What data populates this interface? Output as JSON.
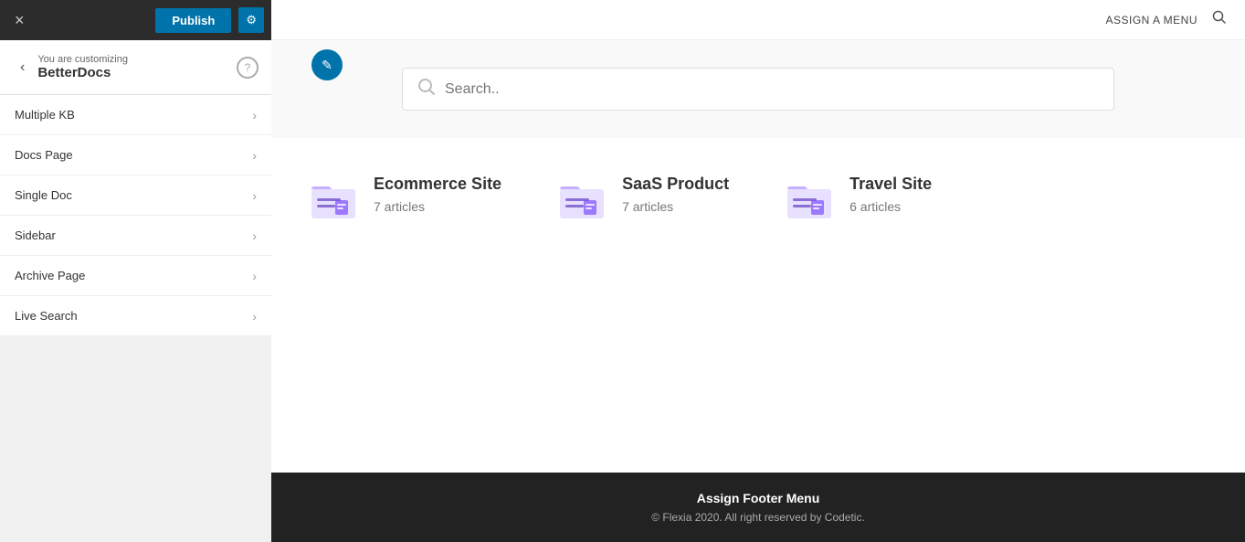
{
  "toolbar": {
    "close_icon": "×",
    "publish_label": "Publish",
    "settings_icon": "⚙"
  },
  "customizing": {
    "back_icon": "‹",
    "label": "You are customizing",
    "title": "BetterDocs",
    "help_icon": "?"
  },
  "menu_items": [
    {
      "label": "Multiple KB",
      "id": "multiple-kb"
    },
    {
      "label": "Docs Page",
      "id": "docs-page"
    },
    {
      "label": "Single Doc",
      "id": "single-doc"
    },
    {
      "label": "Sidebar",
      "id": "sidebar"
    },
    {
      "label": "Archive Page",
      "id": "archive-page"
    },
    {
      "label": "Live Search",
      "id": "live-search"
    }
  ],
  "top_nav": {
    "assign_menu_label": "ASSIGN A MENU",
    "search_icon": "🔍"
  },
  "search": {
    "placeholder": "Search.."
  },
  "cards": [
    {
      "id": "ecommerce",
      "title": "Ecommerce Site",
      "articles": "7 articles"
    },
    {
      "id": "saas",
      "title": "SaaS Product",
      "articles": "7 articles"
    },
    {
      "id": "travel",
      "title": "Travel Site",
      "articles": "6 articles"
    }
  ],
  "footer": {
    "title": "Assign Footer Menu",
    "copyright": "© Flexia 2020. All right reserved by Codetic."
  },
  "edit_icon": "✏"
}
